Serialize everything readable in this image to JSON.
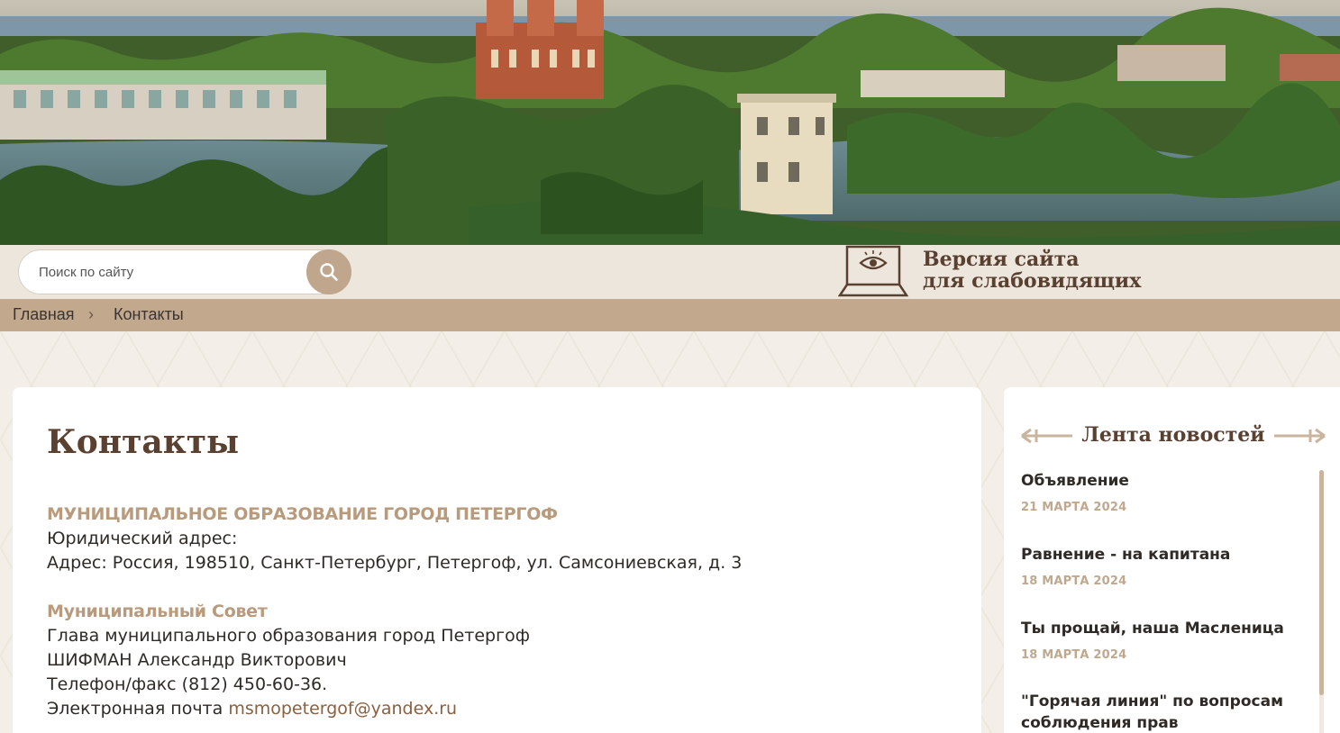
{
  "search": {
    "placeholder": "Поиск по сайту"
  },
  "accessibility": {
    "line1": "Версия сайта",
    "line2": "для слабовидящих"
  },
  "breadcrumb": {
    "home": "Главная",
    "separator": "›",
    "current": "Контакты"
  },
  "page": {
    "title": "Контакты",
    "org": {
      "heading": "МУНИЦИПАЛЬНОЕ ОБРАЗОВАНИЕ ГОРОД ПЕТЕРГОФ",
      "legal_label": "Юридический адрес:",
      "address": "Адрес: Россия, 198510, Санкт-Петербург, Петергоф, ул. Самсониевская, д. 3"
    },
    "council": {
      "heading": "Муниципальный Совет",
      "position": "Глава муниципального образования город Петергоф",
      "person": "ШИФМАН Александр Викторович",
      "phone": "Телефон/факс  (812) 450-60-36.",
      "email_label": "Электронная почта",
      "email": "msmopetergof@yandex.ru"
    }
  },
  "news": {
    "title": "Лента новостей",
    "items": [
      {
        "title": "Объявление",
        "date": "21 МАРТА 2024"
      },
      {
        "title": "Равнение - на капитана",
        "date": "18 МАРТА 2024"
      },
      {
        "title": "Ты прощай, наша Масленица",
        "date": "18 МАРТА 2024"
      },
      {
        "title": "\"Горячая линия\" по вопросам соблюдения прав",
        "date": ""
      }
    ]
  },
  "colors": {
    "accent": "#c2a98e",
    "heading_brown": "#5a4030",
    "date_tan": "#c0a88e"
  }
}
